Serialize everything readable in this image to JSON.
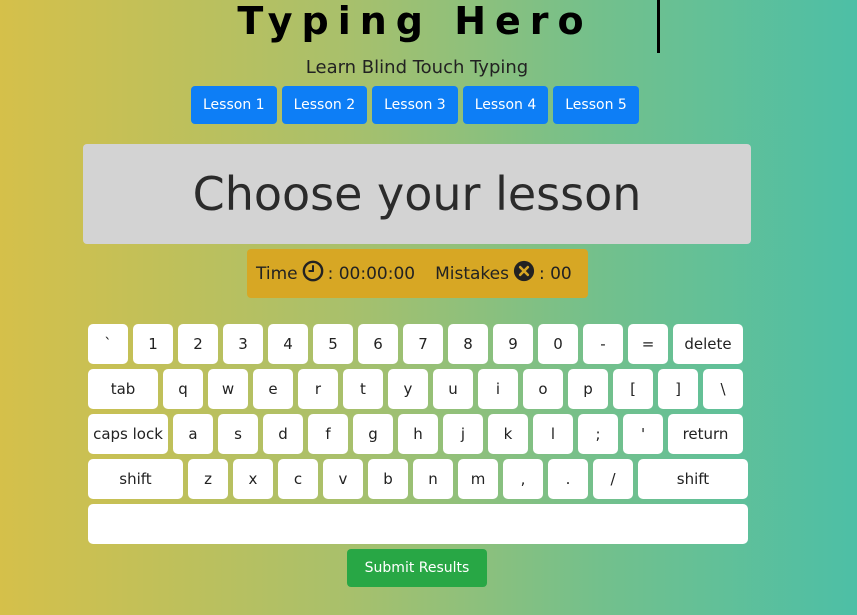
{
  "header": {
    "title": "Typing Hero",
    "subtitle": "Learn Blind Touch Typing"
  },
  "lessons": [
    "Lesson 1",
    "Lesson 2",
    "Lesson 3",
    "Lesson 4",
    "Lesson 5"
  ],
  "display": {
    "text": "Choose your lesson"
  },
  "stats": {
    "time_label": "Time",
    "time_icon": "clock-icon",
    "time_value": ": 00:00:00",
    "mistakes_label": "Mistakes",
    "mistakes_icon": "x-circle-icon",
    "mistakes_value": ": 00"
  },
  "keyboard": {
    "rows": [
      [
        "`",
        "1",
        "2",
        "3",
        "4",
        "5",
        "6",
        "7",
        "8",
        "9",
        "0",
        "-",
        "=",
        "delete"
      ],
      [
        "tab",
        "q",
        "w",
        "e",
        "r",
        "t",
        "y",
        "u",
        "i",
        "o",
        "p",
        "[",
        "]",
        "\\"
      ],
      [
        "caps lock",
        "a",
        "s",
        "d",
        "f",
        "g",
        "h",
        "j",
        "k",
        "l",
        ";",
        "'",
        "return"
      ],
      [
        "shift",
        "z",
        "x",
        "c",
        "v",
        "b",
        "n",
        "m",
        ",",
        ".",
        "/",
        "shift"
      ]
    ]
  },
  "submit_label": "Submit Results",
  "colors": {
    "lesson_button": "#0d7ef6",
    "submit_button": "#28a745",
    "stats_bar": "#d7a724",
    "display_bg": "#d3d3d3"
  }
}
